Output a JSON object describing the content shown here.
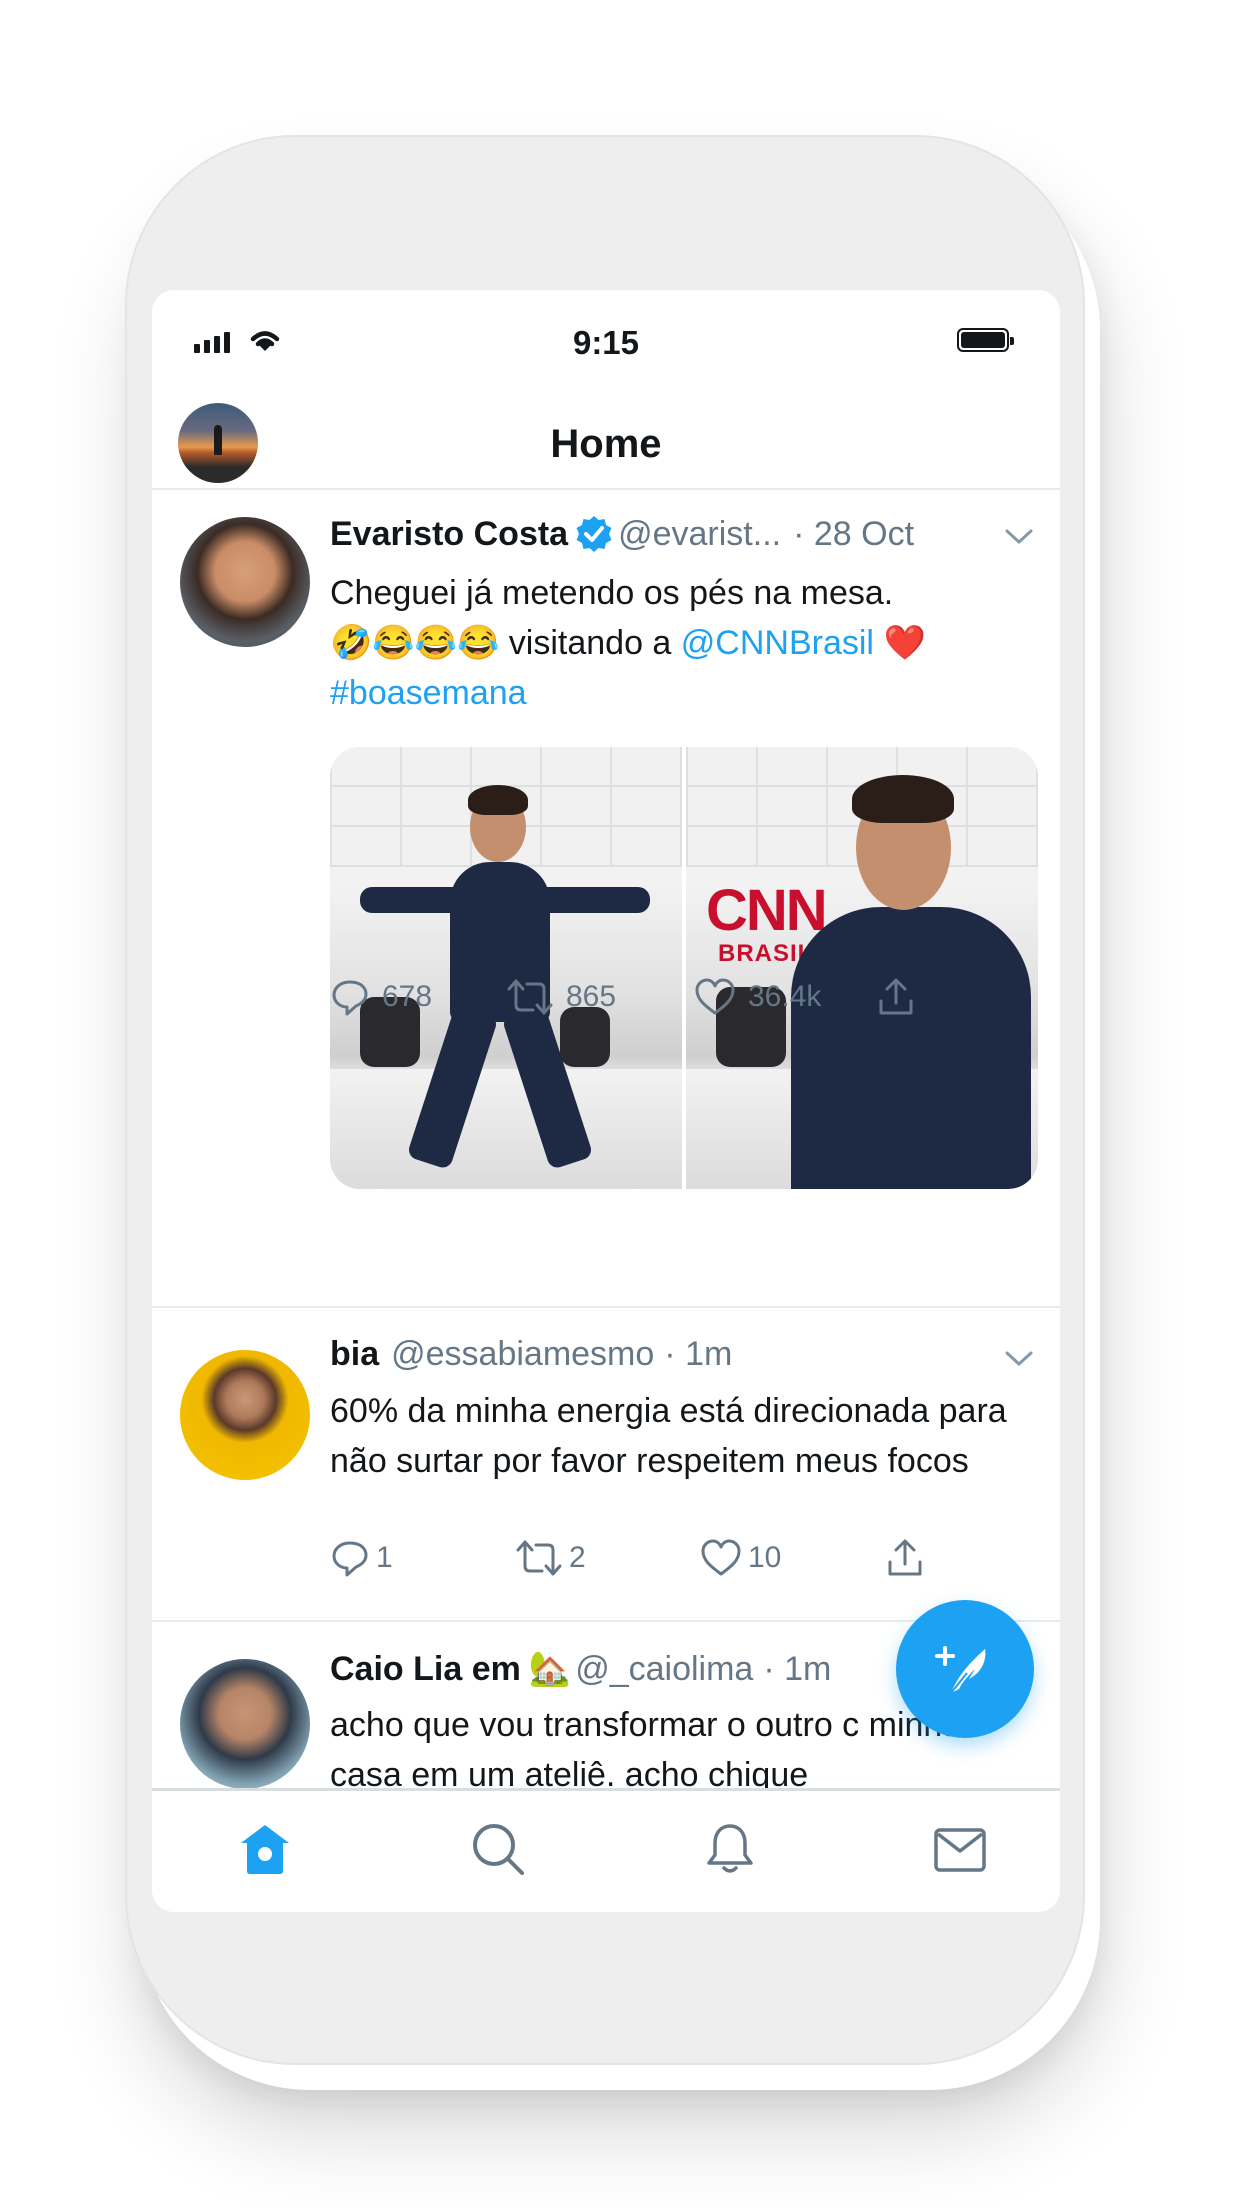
{
  "status_bar": {
    "time": "9:15"
  },
  "header": {
    "title": "Home"
  },
  "tweets": [
    {
      "name": "Evaristo Costa",
      "handle": "@evarist...",
      "time": "· 28 Oct",
      "text_plain_1": "Cheguei já metendo os pés na mesa.",
      "text_emojis": "🤣😂😂😂",
      "text_plain_2": " visitando a ",
      "mention": "@CNNBrasil",
      "heart_emoji": " ❤️",
      "hashtag": "#boasemana",
      "media_text": {
        "logo": "CNN",
        "sub": "BRASIL"
      },
      "replies": "678",
      "retweets": "865",
      "likes": "36.4k"
    },
    {
      "name": "bia",
      "handle": "@essabiamesmo",
      "time": "· 1m",
      "text": "60% da minha energia está direcionada para não surtar por favor respeitem meus focos",
      "replies": "1",
      "retweets": "2",
      "likes": "10"
    },
    {
      "name": "Caio Lia em",
      "name_emoji": "🏡",
      "handle": "@_caiolima",
      "time": "· 1m",
      "text": "acho que vou transformar o outro c minha casa em um ateliê. acho chique"
    }
  ],
  "tabbar": [
    "home-icon",
    "search-icon",
    "notifications-icon",
    "messages-icon"
  ],
  "colors": {
    "accent": "#1da1f2",
    "secondary_text": "#657786",
    "divider": "#e6ecf0"
  }
}
